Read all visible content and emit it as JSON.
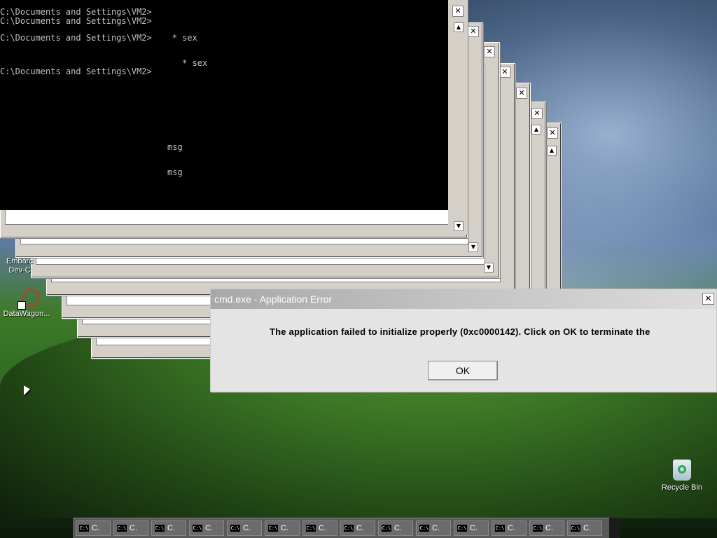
{
  "console": {
    "lines": [
      "C:\\Documents and Settings\\VM2>",
      "C:\\Documents and Settings\\VM2>",
      "C:\\Documents and Settings\\VM2>    * sex",
      "                                    * sex",
      "C:\\Documents and Settings\\VM2>",
      "msg",
      "msg"
    ]
  },
  "desktop": {
    "icons": [
      {
        "label": "Embarc\nDev-C",
        "icon": "embarcadero-icon"
      },
      {
        "label": "DataWagon...",
        "icon": "datawagon-icon"
      },
      {
        "label": "Recycle Bin",
        "icon": "recycle-bin-icon"
      }
    ]
  },
  "dialog": {
    "title": "cmd.exe - Application Error",
    "message": "The application failed to initialize properly (0xc0000142). Click on OK to terminate the",
    "ok_label": "OK",
    "close_label": "✕"
  },
  "taskbar": {
    "items": [
      "C.",
      "C.",
      "C.",
      "C.",
      "C.",
      "C.",
      "C.",
      "C.",
      "C.",
      "C.",
      "C.",
      "C.",
      "C.",
      "C."
    ],
    "item_icon_text": "C:\\"
  },
  "window_buttons": {
    "close": "✕",
    "minimize": "_",
    "maximize": "□",
    "scroll_up": "▲",
    "scroll_down": "▼"
  }
}
